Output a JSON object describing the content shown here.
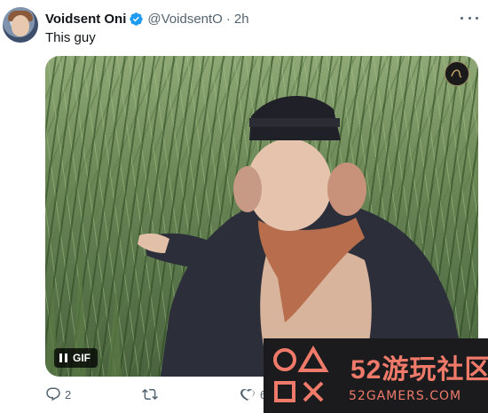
{
  "tweet": {
    "display_name": "Voidsent Oni",
    "handle": "@VoidsentO",
    "separator": "·",
    "time": "2h",
    "text": "This guy",
    "verified": true
  },
  "media": {
    "badge_label": "GIF",
    "playing_icon": "pause-icon",
    "channel_logo_icon": "channel-logo-icon"
  },
  "actions": {
    "reply_count": "2",
    "retweet_count": "",
    "like_count": "6"
  },
  "watermark": {
    "brand": "52游玩社区",
    "site": "52GAMERS.COM"
  },
  "colors": {
    "verified_blue": "#1d9bf0",
    "secondary_text": "#536471",
    "watermark_accent": "#f07a6a"
  }
}
